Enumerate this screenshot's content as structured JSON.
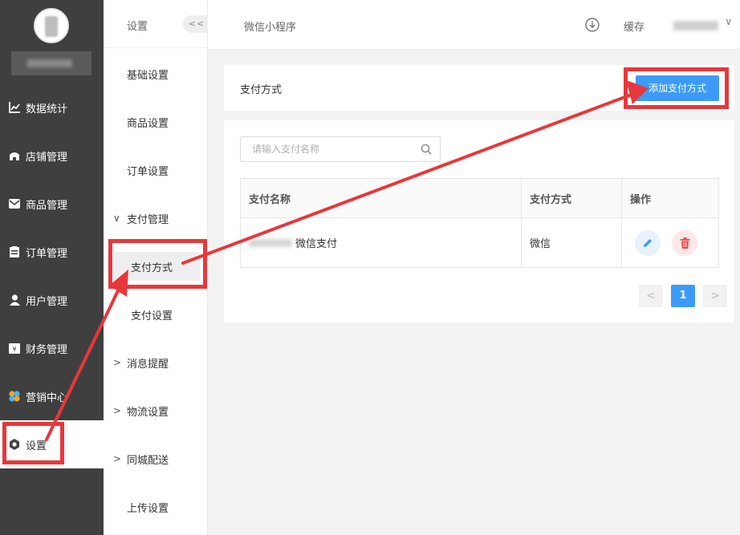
{
  "sidebar": {
    "items": [
      {
        "label": "数据统计",
        "icon": "chart-line-icon"
      },
      {
        "label": "店铺管理",
        "icon": "store-icon"
      },
      {
        "label": "商品管理",
        "icon": "mail-icon"
      },
      {
        "label": "订单管理",
        "icon": "clipboard-icon"
      },
      {
        "label": "用户管理",
        "icon": "user-icon"
      },
      {
        "label": "财务管理",
        "icon": "finance-icon"
      },
      {
        "label": "营销中心",
        "icon": "marketing-icon"
      },
      {
        "label": "设置",
        "icon": "gear-icon"
      }
    ]
  },
  "submenu": {
    "title": "设置",
    "collapse_label": "<<",
    "items": [
      {
        "label": "基础设置"
      },
      {
        "label": "商品设置"
      },
      {
        "label": "订单设置"
      },
      {
        "label": "支付管理",
        "chevron": "∨"
      },
      {
        "label": "消息提醒",
        "chevron": ">"
      },
      {
        "label": "物流设置",
        "chevron": ">"
      },
      {
        "label": "同城配送",
        "chevron": ">"
      },
      {
        "label": "上传设置"
      }
    ],
    "children": [
      {
        "label": "支付方式"
      },
      {
        "label": "支付设置"
      }
    ]
  },
  "topbar": {
    "title": "微信小程序",
    "cache_label": "缓存",
    "user_caret": "∨"
  },
  "page": {
    "section_title": "支付方式",
    "add_button": "添加支付方式"
  },
  "search": {
    "placeholder": "请输入支付名称"
  },
  "table": {
    "headers": [
      "支付名称",
      "支付方式",
      "操作"
    ],
    "rows": [
      {
        "name": "微信支付",
        "method": "微信"
      }
    ]
  },
  "pagination": {
    "prev": "<",
    "current": "1",
    "next": ">"
  },
  "colors": {
    "primary": "#3d9bf7",
    "annotation_red": "#e8373b",
    "sidebar_bg": "#3f3f3f"
  }
}
